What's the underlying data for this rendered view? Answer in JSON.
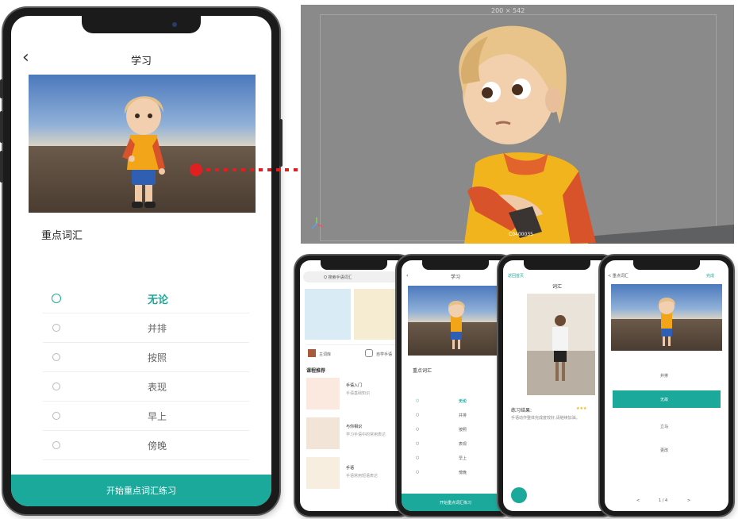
{
  "main_phone": {
    "title": "学习",
    "section_title": "重点词汇",
    "options": [
      "无论",
      "并排",
      "按照",
      "表现",
      "早上",
      "傍晚"
    ],
    "selected_index": 0,
    "start_button": "开始重点词汇练习"
  },
  "editor": {
    "size_readout": "200 × 542",
    "badge_text": "C0400035"
  },
  "phone_home": {
    "search_placeholder": "Q 搜索手语词汇",
    "cat1": "主词库",
    "cat2": "自学手语",
    "section": "课程推荐",
    "courses": [
      {
        "title": "手语入门",
        "sub": "手语基础知识"
      },
      {
        "title": "与你相识",
        "sub": "学习手语中的常用表达"
      },
      {
        "title": "手语",
        "sub": "手语常用短语表达"
      }
    ]
  },
  "phone_learn": {
    "title": "学习",
    "section_title": "重点词汇",
    "options": [
      "无论",
      "并排",
      "按照",
      "表现",
      "早上",
      "傍晚"
    ],
    "start_button": "开始重点词汇练习"
  },
  "phone_practice": {
    "top_back": "返回首页",
    "title": "词汇",
    "result_label": "练习结果:",
    "result_text": "手语动作整体完成度较好,请继续加油。",
    "rating": 3
  },
  "phone_quiz": {
    "back": "< 重点词汇",
    "right": "完成",
    "options": [
      "并排",
      "无故",
      "立马",
      "更改"
    ],
    "selected_index": 1,
    "pager": "1 / 4",
    "prev": "<",
    "next": ">"
  },
  "colors": {
    "accent": "#1aa99b",
    "arrow": "#e02020"
  }
}
